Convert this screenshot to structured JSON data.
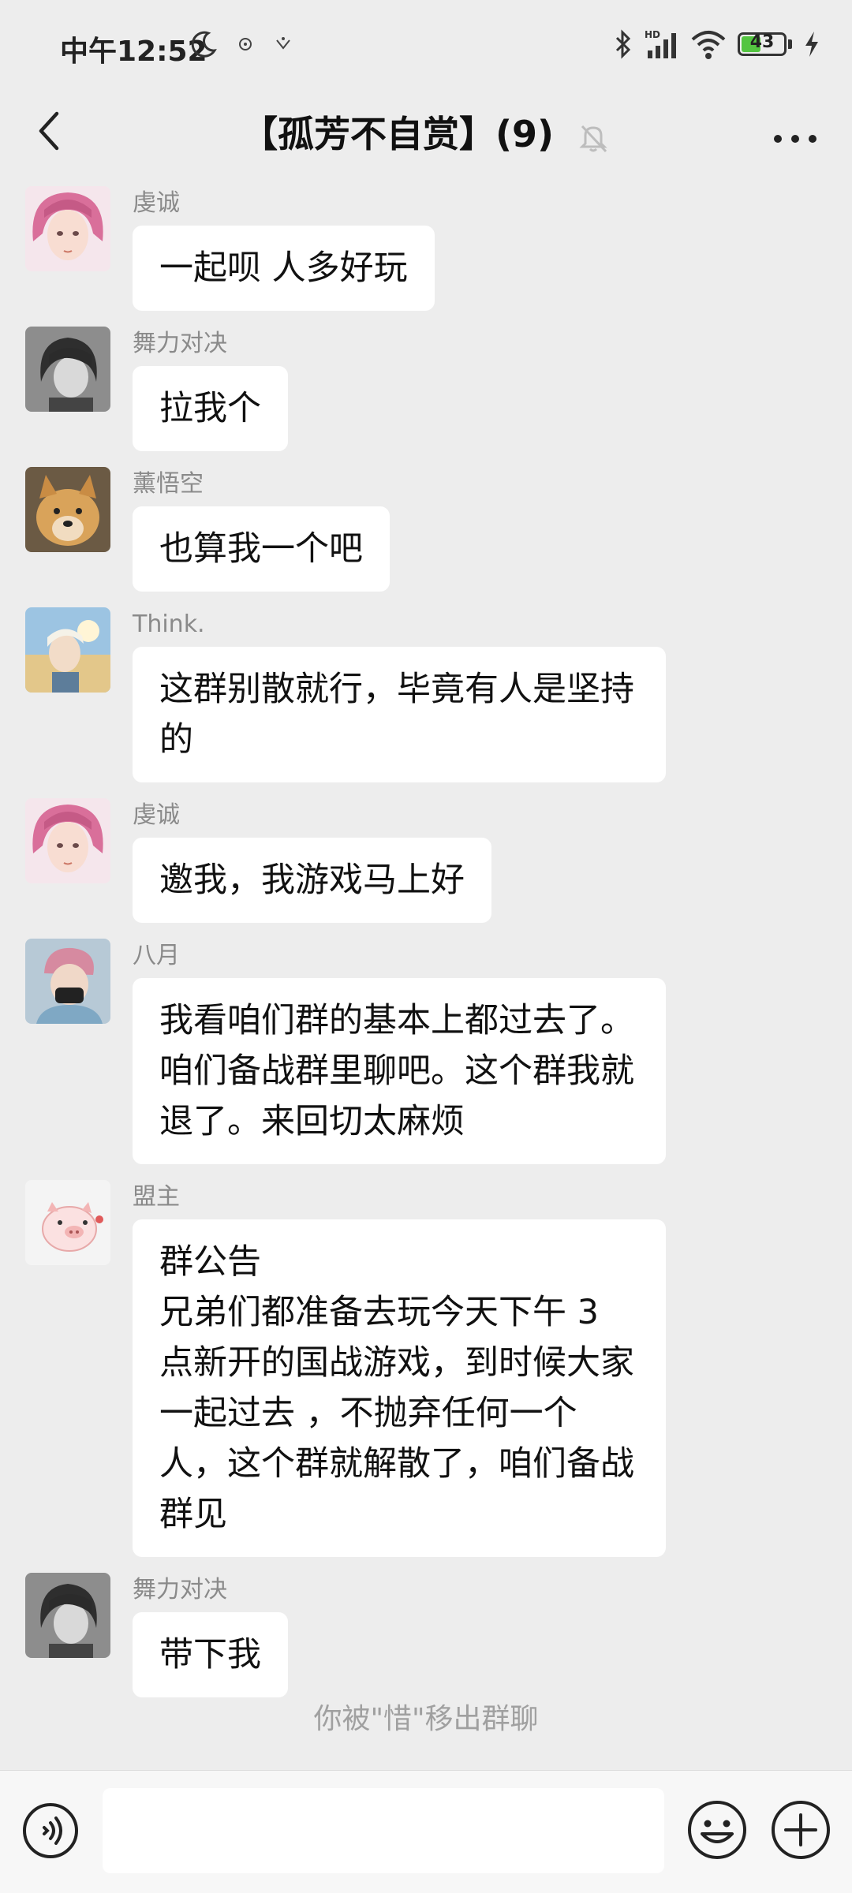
{
  "status_bar": {
    "time": "中午12:52",
    "battery_level": "43",
    "icons": [
      "moon-icon",
      "notification-icon",
      "notification-icon",
      "bluetooth-icon",
      "signal-icon",
      "wifi-icon",
      "battery-icon",
      "charging-icon"
    ],
    "signal_label": "HD"
  },
  "header": {
    "title": "【孤芳不自赏】(9)",
    "muted": true
  },
  "messages": [
    {
      "sender": "虔诚",
      "text": "一起呗 人多好玩",
      "avatar": "avatar-pink-hair"
    },
    {
      "sender": "舞力对决",
      "text": "拉我个",
      "avatar": "avatar-gray-boy"
    },
    {
      "sender": "薰悟空",
      "text": "也算我一个吧",
      "avatar": "avatar-dog"
    },
    {
      "sender": "Think.",
      "text": "这群别散就行，毕竟有人是坚持的",
      "avatar": "avatar-sky-boy"
    },
    {
      "sender": "虔诚",
      "text": "邀我，我游戏马上好",
      "avatar": "avatar-pink-hair"
    },
    {
      "sender": "八月",
      "text": "我看咱们群的基本上都过去了。咱们备战群里聊吧。这个群我就退了。来回切太麻烦",
      "avatar": "avatar-mask-boy"
    },
    {
      "sender": "盟主",
      "text": "群公告\n兄弟们都准备去玩今天下午 3 点新开的国战游戏，到时候大家一起过去 ，不抛弃任何一个人，这个群就解散了，咱们备战群见",
      "avatar": "avatar-pig"
    },
    {
      "sender": "舞力对决",
      "text": "带下我",
      "avatar": "avatar-gray-boy"
    }
  ],
  "system_message": "你被\"惜\"移出群聊",
  "input": {
    "value": "",
    "placeholder": ""
  },
  "colors": {
    "background": "#ededed",
    "bubble": "#ffffff",
    "battery": "#54c541"
  }
}
